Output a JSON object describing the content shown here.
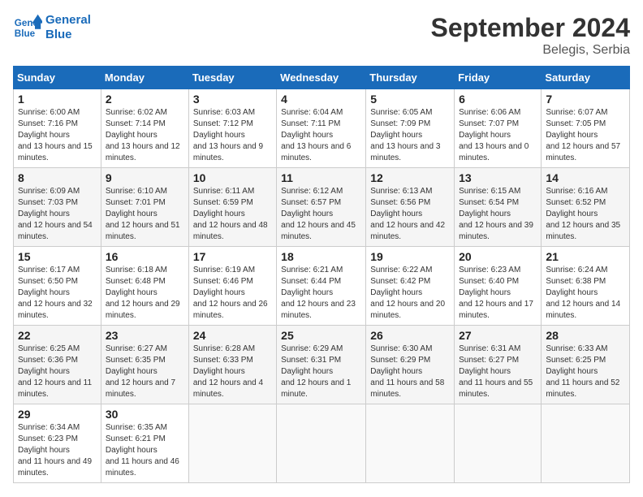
{
  "logo": {
    "line1": "General",
    "line2": "Blue"
  },
  "title": "September 2024",
  "subtitle": "Belegis, Serbia",
  "days_of_week": [
    "Sunday",
    "Monday",
    "Tuesday",
    "Wednesday",
    "Thursday",
    "Friday",
    "Saturday"
  ],
  "weeks": [
    [
      {
        "day": "1",
        "sunrise": "6:00 AM",
        "sunset": "7:16 PM",
        "daylight": "13 hours and 15 minutes."
      },
      {
        "day": "2",
        "sunrise": "6:02 AM",
        "sunset": "7:14 PM",
        "daylight": "13 hours and 12 minutes."
      },
      {
        "day": "3",
        "sunrise": "6:03 AM",
        "sunset": "7:12 PM",
        "daylight": "13 hours and 9 minutes."
      },
      {
        "day": "4",
        "sunrise": "6:04 AM",
        "sunset": "7:11 PM",
        "daylight": "13 hours and 6 minutes."
      },
      {
        "day": "5",
        "sunrise": "6:05 AM",
        "sunset": "7:09 PM",
        "daylight": "13 hours and 3 minutes."
      },
      {
        "day": "6",
        "sunrise": "6:06 AM",
        "sunset": "7:07 PM",
        "daylight": "13 hours and 0 minutes."
      },
      {
        "day": "7",
        "sunrise": "6:07 AM",
        "sunset": "7:05 PM",
        "daylight": "12 hours and 57 minutes."
      }
    ],
    [
      {
        "day": "8",
        "sunrise": "6:09 AM",
        "sunset": "7:03 PM",
        "daylight": "12 hours and 54 minutes."
      },
      {
        "day": "9",
        "sunrise": "6:10 AM",
        "sunset": "7:01 PM",
        "daylight": "12 hours and 51 minutes."
      },
      {
        "day": "10",
        "sunrise": "6:11 AM",
        "sunset": "6:59 PM",
        "daylight": "12 hours and 48 minutes."
      },
      {
        "day": "11",
        "sunrise": "6:12 AM",
        "sunset": "6:57 PM",
        "daylight": "12 hours and 45 minutes."
      },
      {
        "day": "12",
        "sunrise": "6:13 AM",
        "sunset": "6:56 PM",
        "daylight": "12 hours and 42 minutes."
      },
      {
        "day": "13",
        "sunrise": "6:15 AM",
        "sunset": "6:54 PM",
        "daylight": "12 hours and 39 minutes."
      },
      {
        "day": "14",
        "sunrise": "6:16 AM",
        "sunset": "6:52 PM",
        "daylight": "12 hours and 35 minutes."
      }
    ],
    [
      {
        "day": "15",
        "sunrise": "6:17 AM",
        "sunset": "6:50 PM",
        "daylight": "12 hours and 32 minutes."
      },
      {
        "day": "16",
        "sunrise": "6:18 AM",
        "sunset": "6:48 PM",
        "daylight": "12 hours and 29 minutes."
      },
      {
        "day": "17",
        "sunrise": "6:19 AM",
        "sunset": "6:46 PM",
        "daylight": "12 hours and 26 minutes."
      },
      {
        "day": "18",
        "sunrise": "6:21 AM",
        "sunset": "6:44 PM",
        "daylight": "12 hours and 23 minutes."
      },
      {
        "day": "19",
        "sunrise": "6:22 AM",
        "sunset": "6:42 PM",
        "daylight": "12 hours and 20 minutes."
      },
      {
        "day": "20",
        "sunrise": "6:23 AM",
        "sunset": "6:40 PM",
        "daylight": "12 hours and 17 minutes."
      },
      {
        "day": "21",
        "sunrise": "6:24 AM",
        "sunset": "6:38 PM",
        "daylight": "12 hours and 14 minutes."
      }
    ],
    [
      {
        "day": "22",
        "sunrise": "6:25 AM",
        "sunset": "6:36 PM",
        "daylight": "12 hours and 11 minutes."
      },
      {
        "day": "23",
        "sunrise": "6:27 AM",
        "sunset": "6:35 PM",
        "daylight": "12 hours and 7 minutes."
      },
      {
        "day": "24",
        "sunrise": "6:28 AM",
        "sunset": "6:33 PM",
        "daylight": "12 hours and 4 minutes."
      },
      {
        "day": "25",
        "sunrise": "6:29 AM",
        "sunset": "6:31 PM",
        "daylight": "12 hours and 1 minute."
      },
      {
        "day": "26",
        "sunrise": "6:30 AM",
        "sunset": "6:29 PM",
        "daylight": "11 hours and 58 minutes."
      },
      {
        "day": "27",
        "sunrise": "6:31 AM",
        "sunset": "6:27 PM",
        "daylight": "11 hours and 55 minutes."
      },
      {
        "day": "28",
        "sunrise": "6:33 AM",
        "sunset": "6:25 PM",
        "daylight": "11 hours and 52 minutes."
      }
    ],
    [
      {
        "day": "29",
        "sunrise": "6:34 AM",
        "sunset": "6:23 PM",
        "daylight": "11 hours and 49 minutes."
      },
      {
        "day": "30",
        "sunrise": "6:35 AM",
        "sunset": "6:21 PM",
        "daylight": "11 hours and 46 minutes."
      },
      null,
      null,
      null,
      null,
      null
    ]
  ]
}
